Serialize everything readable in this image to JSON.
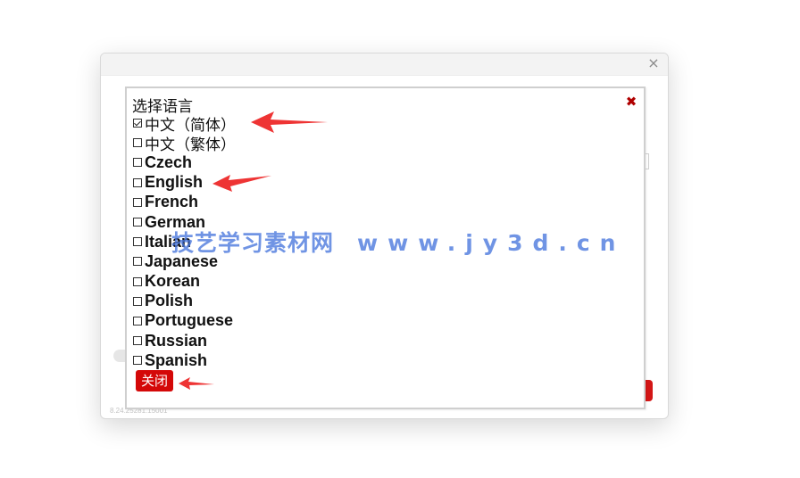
{
  "outer_dialog": {
    "close_symbol": "×",
    "version": "8.24.25281.15001"
  },
  "language_panel": {
    "title": "选择语言",
    "close_symbol": "✖",
    "languages": [
      {
        "label": "中文（简体）",
        "checked": true
      },
      {
        "label": "中文（繁体）",
        "checked": false
      },
      {
        "label": "Czech",
        "checked": false
      },
      {
        "label": "English",
        "checked": false
      },
      {
        "label": "French",
        "checked": false
      },
      {
        "label": "German",
        "checked": false
      },
      {
        "label": "Italian",
        "checked": false
      },
      {
        "label": "Japanese",
        "checked": false
      },
      {
        "label": "Korean",
        "checked": false
      },
      {
        "label": "Polish",
        "checked": false
      },
      {
        "label": "Portuguese",
        "checked": false
      },
      {
        "label": "Russian",
        "checked": false
      },
      {
        "label": "Spanish",
        "checked": false
      }
    ],
    "close_button_label": "关闭"
  },
  "watermark": {
    "site_name": "技艺学习素材网",
    "url": "www.jy3d.cn"
  },
  "colors": {
    "close_button": "#d40808",
    "panel_close_icon": "#b00000",
    "annotation_arrow": "#ee3434",
    "watermark": "#4876dc"
  }
}
